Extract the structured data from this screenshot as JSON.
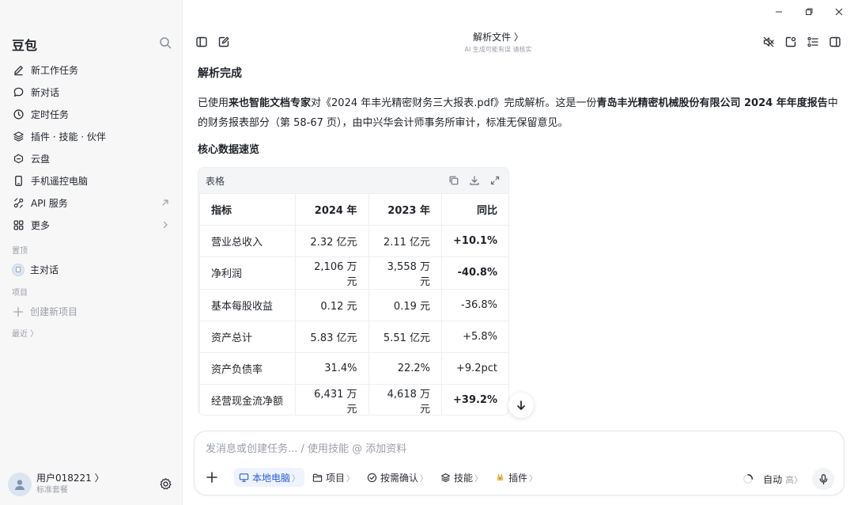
{
  "window": {
    "controls": [
      "minimize-icon",
      "restore-icon",
      "close-icon"
    ]
  },
  "sidebar": {
    "brand": "豆包",
    "items": [
      {
        "label": "新工作任务",
        "icon": "edit-icon"
      },
      {
        "label": "新对话",
        "icon": "chat-bubble-icon"
      },
      {
        "label": "定时任务",
        "icon": "clock-icon"
      },
      {
        "label": "插件 · 技能 · 伙伴",
        "icon": "layers-icon"
      },
      {
        "label": "云盘",
        "icon": "cloud-icon"
      },
      {
        "label": "手机遥控电脑",
        "icon": "phone-icon"
      },
      {
        "label": "API 服务",
        "icon": "api-icon",
        "tail": "arrow-up-right-icon"
      },
      {
        "label": "更多",
        "icon": "grid-icon",
        "tail": "chevron-right-icon"
      }
    ],
    "pinned_label": "置顶",
    "pinned_item": "主对话",
    "projects_label": "项目",
    "new_project": "创建新项目",
    "recent_label": "最近 〉",
    "user": {
      "name": "用户018221 〉",
      "plan": "标准套餐"
    }
  },
  "header": {
    "title": "解析文件 〉",
    "subtitle": "AI 生成可能有误 请核实"
  },
  "content": {
    "title": "解析完成",
    "para": {
      "p1": "已使用",
      "b1": "来也智能文档专家",
      "p2": "对《2024 年丰光精密财务三大报表.pdf》完成解析。这是一份",
      "b2": "青岛丰光精密机械股份有限公司 2024 年年度报告",
      "p3": "中的财务报表部分（第 58-67 页），由中兴华会计师事务所审计，标准无保留意见。"
    },
    "subtitle": "核心数据速览",
    "table": {
      "label": "表格",
      "headers": [
        "指标",
        "2024 年",
        "2023 年",
        "同比"
      ],
      "rows": [
        [
          "营业总收入",
          "2.32 亿元",
          "2.11 亿元",
          "+10.1%"
        ],
        [
          "净利润",
          "2,106 万元",
          "3,558 万元",
          "-40.8%"
        ],
        [
          "基本每股收益",
          "0.12 元",
          "0.19 元",
          "-36.8%"
        ],
        [
          "资产总计",
          "5.83 亿元",
          "5.51 亿元",
          "+5.8%"
        ],
        [
          "资产负债率",
          "31.4%",
          "22.2%",
          "+9.2pct"
        ],
        [
          "经营现金流净额",
          "6,431 万元",
          "4,618 万元",
          "+39.2%"
        ]
      ]
    }
  },
  "composer": {
    "placeholder": "发消息或创建任务... / 使用技能 @ 添加资料",
    "chips": [
      {
        "label": "本地电脑",
        "icon": "monitor-icon"
      },
      {
        "label": "项目",
        "icon": "folder-icon"
      },
      {
        "label": "按需确认",
        "icon": "check-circle-icon"
      },
      {
        "label": "技能",
        "icon": "layers-icon"
      },
      {
        "label": "插件",
        "icon": "plugin-icon"
      }
    ],
    "mode": "自动",
    "mode_level": "高",
    "chevron": "〉"
  },
  "colors": {
    "accent": "#2a5bd7",
    "sidebar_bg": "#f7f7f8",
    "table_bg": "#f4f5f7"
  }
}
